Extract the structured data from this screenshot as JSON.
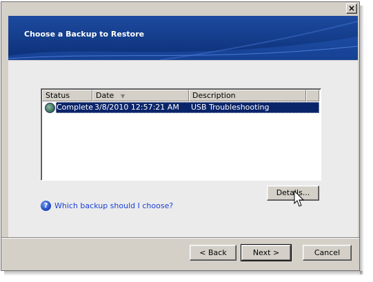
{
  "window": {
    "close_glyph": "×",
    "banner_title": "Choose a Backup to Restore"
  },
  "list": {
    "columns": [
      {
        "label": "Status"
      },
      {
        "label": "Date"
      },
      {
        "label": "Description"
      }
    ],
    "sort_indicator": "▼",
    "rows": [
      {
        "status": "Complete",
        "date": "3/8/2010 12:57:21 AM",
        "description": "USB Troubleshooting",
        "selected": true
      }
    ]
  },
  "details_button": "Details...",
  "help": {
    "icon": "help-icon",
    "glyph": "?",
    "link_text": "Which backup should I choose?"
  },
  "footer": {
    "back": "< Back",
    "next": "Next >",
    "cancel": "Cancel"
  },
  "colors": {
    "banner": "#16408f",
    "selection": "#0a246a",
    "link": "#1a3fd6",
    "dialog_face": "#d4d0c8"
  }
}
